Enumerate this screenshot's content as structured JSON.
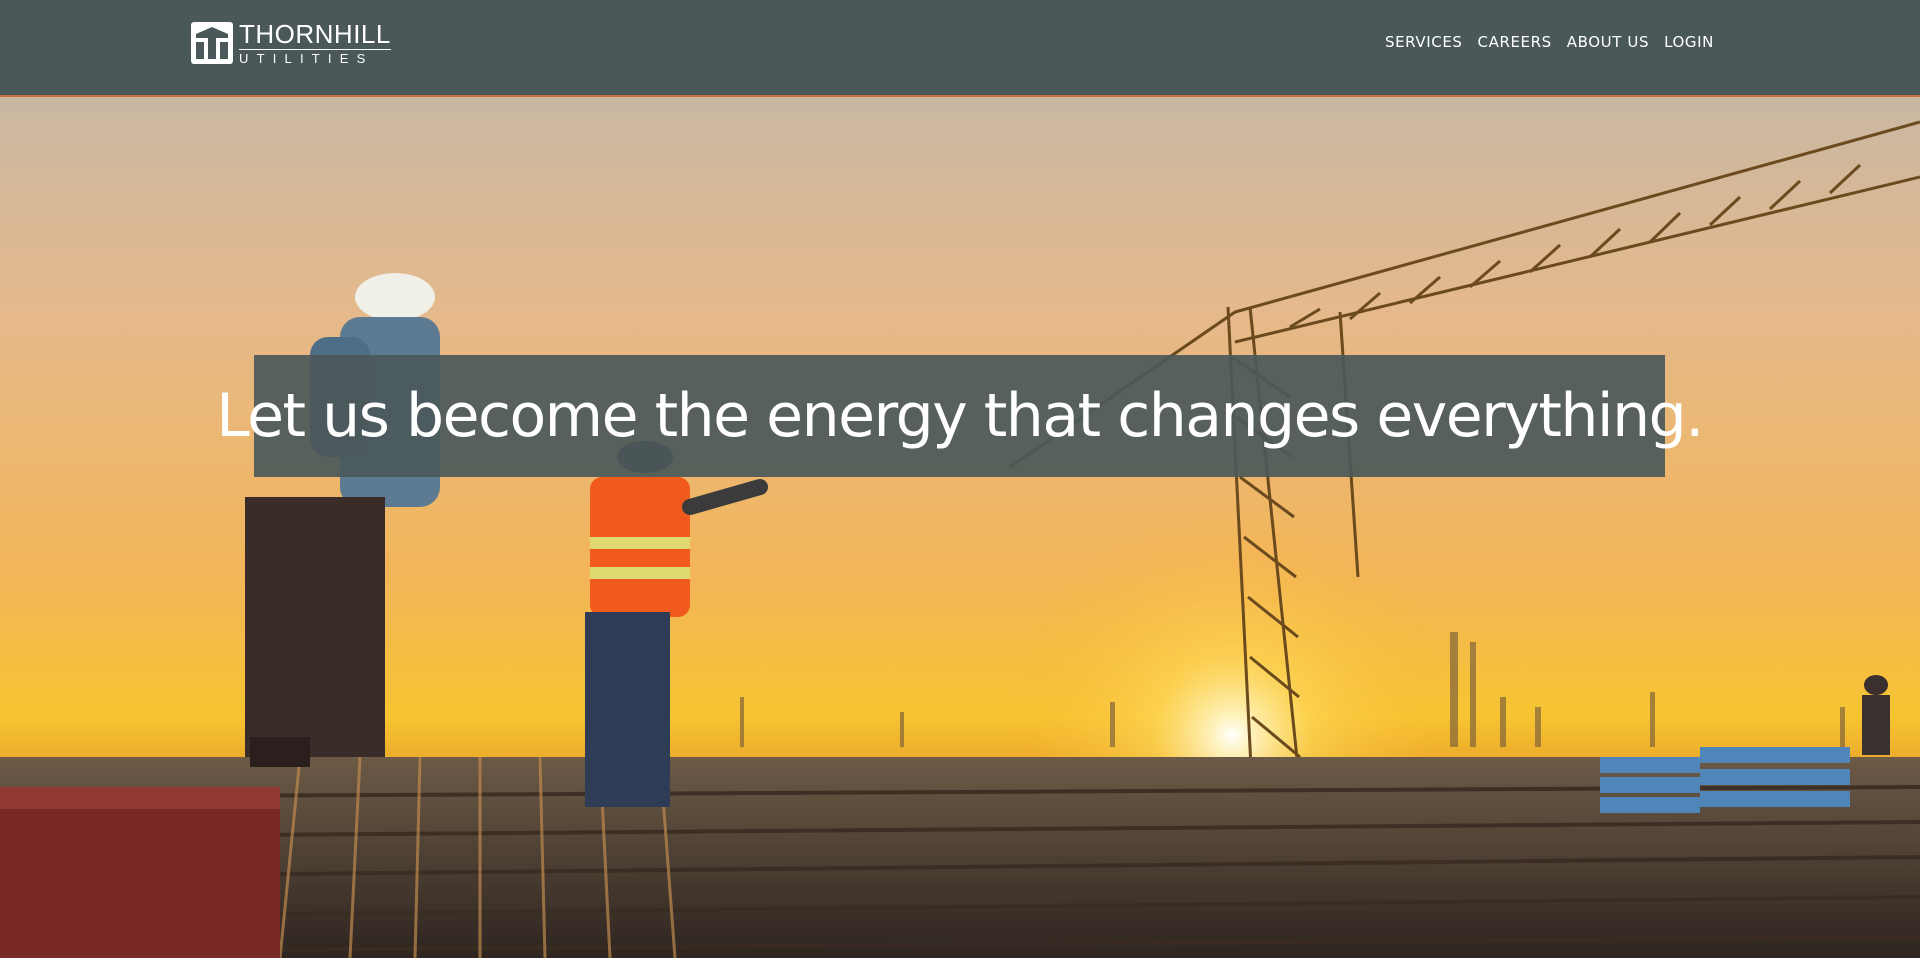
{
  "brand": {
    "name_line1": "THORNHILL",
    "name_line2": "UTILITIES",
    "logo_icon": "thornhill-logo-icon"
  },
  "nav": {
    "items": [
      {
        "label": "SERVICES"
      },
      {
        "label": "CAREERS"
      },
      {
        "label": "ABOUT US"
      },
      {
        "label": "LOGIN"
      }
    ]
  },
  "hero": {
    "tagline": "Let us become the energy that changes everything."
  },
  "colors": {
    "header_bg": "#4b5859",
    "header_border": "#c9703a",
    "tagline_bg": "#4b5859",
    "text": "#ffffff"
  }
}
